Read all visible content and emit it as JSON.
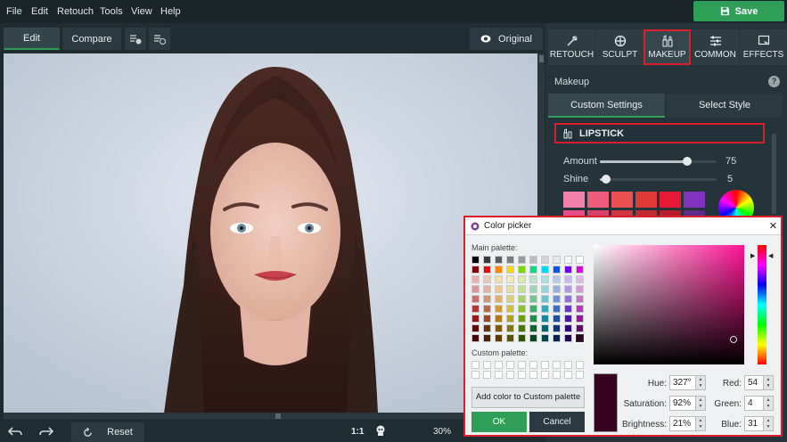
{
  "menu": {
    "items": [
      "File",
      "Edit",
      "Retouch",
      "Tools",
      "View",
      "Help"
    ]
  },
  "save_button": "Save",
  "toolbar": {
    "edit": "Edit",
    "compare": "Compare",
    "original": "Original"
  },
  "bottom": {
    "reset": "Reset",
    "ratio": "1:1",
    "zoom": "30%"
  },
  "tabs": [
    {
      "label": "RETOUCH",
      "icon": "retouch-icon"
    },
    {
      "label": "SCULPT",
      "icon": "sculpt-icon"
    },
    {
      "label": "MAKEUP",
      "icon": "makeup-icon"
    },
    {
      "label": "COMMON",
      "icon": "sliders-icon"
    },
    {
      "label": "EFFECTS",
      "icon": "effects-icon"
    }
  ],
  "panel": {
    "title": "Makeup",
    "help": "?",
    "subtabs": {
      "custom": "Custom Settings",
      "style": "Select Style"
    },
    "section": "LIPSTICK",
    "amount": {
      "label": "Amount",
      "value": "75",
      "level": 0.75
    },
    "shine": {
      "label": "Shine",
      "value": "5",
      "level": 0.05
    },
    "swatches_row1": [
      "#f080a8",
      "#ee5d7c",
      "#ea5152",
      "#df3a38",
      "#e51835",
      "#8133c0"
    ],
    "swatches_row2": [
      "#e84d8a",
      "#d8406a",
      "#d23640",
      "#c02a32",
      "#b51d2a",
      "#5e2a8a"
    ]
  },
  "color_picker": {
    "title": "Color picker",
    "close": "×",
    "main_palette_label": "Main palette:",
    "custom_palette_label": "Custom palette:",
    "add_button": "Add color to Custom palette",
    "ok": "OK",
    "cancel": "Cancel",
    "hue_label": "Hue:",
    "hue": "327°",
    "saturation_label": "Saturation:",
    "saturation": "92%",
    "brightness_label": "Brightness:",
    "brightness": "21%",
    "red_label": "Red:",
    "red": "54",
    "green_label": "Green:",
    "green": "4",
    "blue_label": "Blue:",
    "blue": "31",
    "selected_color": "#36041f",
    "main_palette": [
      [
        "#000000",
        "#3a3a3a",
        "#5b5b5b",
        "#7b7b7b",
        "#9b9b9b",
        "#bcbcbc",
        "#d4d4d4",
        "#e8e8e8",
        "#f4f4f4",
        "#ffffff"
      ],
      [
        "#7d0000",
        "#ff0000",
        "#ff8800",
        "#ffd800",
        "#7dd800",
        "#00e080",
        "#00d8f0",
        "#0058f0",
        "#7000f0",
        "#e000e0"
      ],
      [
        "#e8b0b0",
        "#f0c8b0",
        "#f4dcb0",
        "#f4ecb0",
        "#d8ecb0",
        "#b8e4c8",
        "#b0e0e4",
        "#b0c8ec",
        "#c8b8ec",
        "#e4b8e4"
      ],
      [
        "#d89898",
        "#e8b098",
        "#ecc898",
        "#ece098",
        "#c4e098",
        "#98d8b0",
        "#98d0d8",
        "#98b0e0",
        "#b098e0",
        "#d898d8"
      ],
      [
        "#c87070",
        "#d89070",
        "#e0b070",
        "#e0d070",
        "#a8d070",
        "#70c890",
        "#70c0cc",
        "#7090d8",
        "#9070d8",
        "#c870c8"
      ],
      [
        "#b03838",
        "#c06838",
        "#d09838",
        "#d0c038",
        "#88c038",
        "#38b068",
        "#38a8b8",
        "#3870c8",
        "#6838c8",
        "#b838b8"
      ],
      [
        "#901818",
        "#a04818",
        "#b07818",
        "#b0a018",
        "#68a018",
        "#189048",
        "#188898",
        "#1850a8",
        "#4818a8",
        "#981898"
      ],
      [
        "#600808",
        "#703008",
        "#805808",
        "#807808",
        "#487808",
        "#086830",
        "#086070",
        "#083878",
        "#300878",
        "#680868"
      ],
      [
        "#400404",
        "#4c2004",
        "#5c3c04",
        "#5c5404",
        "#305404",
        "#044820",
        "#04444c",
        "#042450",
        "#200450",
        "#36041f"
      ]
    ]
  }
}
